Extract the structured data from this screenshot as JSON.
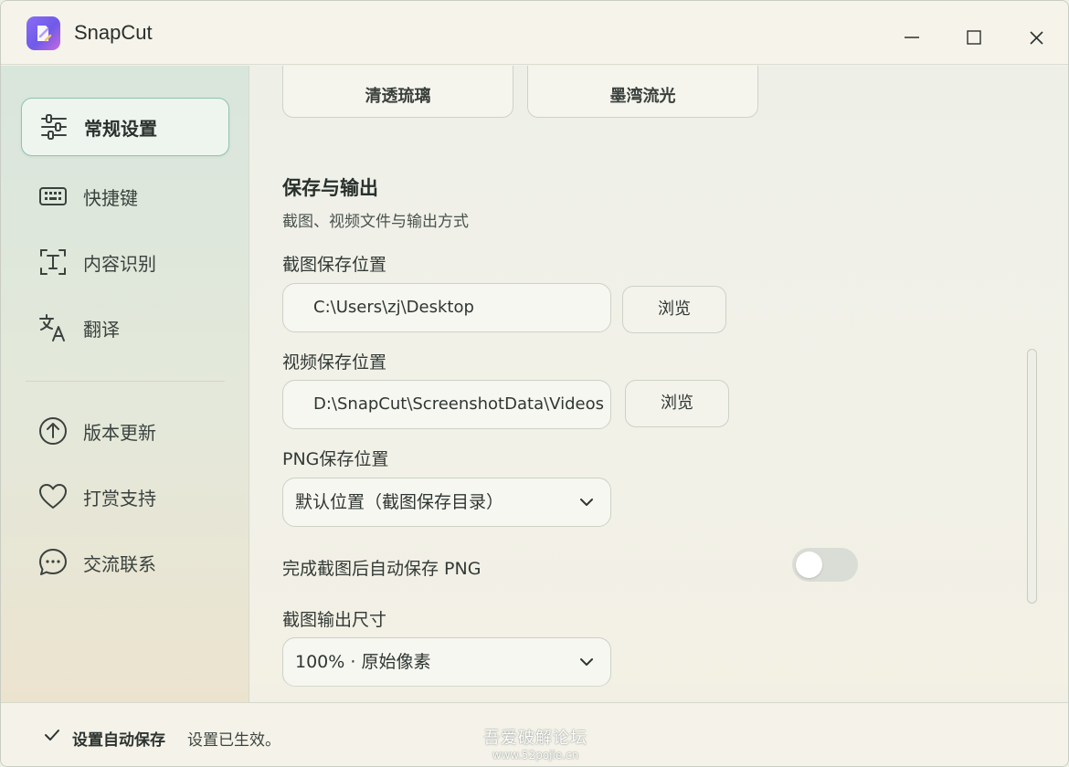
{
  "app": {
    "title": "SnapCut"
  },
  "sidebar": {
    "items": [
      {
        "label": "常规设置",
        "icon": "sliders-icon",
        "active": true
      },
      {
        "label": "快捷键",
        "icon": "keyboard-icon",
        "active": false
      },
      {
        "label": "内容识别",
        "icon": "text-scan-icon",
        "active": false
      },
      {
        "label": "翻译",
        "icon": "translate-icon",
        "active": false
      },
      {
        "label": "版本更新",
        "icon": "arrow-up-circle-icon",
        "active": false
      },
      {
        "label": "打赏支持",
        "icon": "heart-icon",
        "active": false
      },
      {
        "label": "交流联系",
        "icon": "chat-bubble-icon",
        "active": false
      }
    ]
  },
  "main": {
    "theme_buttons": [
      "清透琉璃",
      "墨湾流光"
    ],
    "section": {
      "title": "保存与输出",
      "subtitle": "截图、视频文件与输出方式"
    },
    "screenshot_path": {
      "label": "截图保存位置",
      "value": "C:\\Users\\zj\\Desktop",
      "browse": "浏览"
    },
    "video_path": {
      "label": "视频保存位置",
      "value": "D:\\SnapCut\\ScreenshotData\\Videos",
      "browse": "浏览"
    },
    "png_path": {
      "label": "PNG保存位置",
      "selected": "默认位置（截图保存目录）"
    },
    "auto_save_png": {
      "label": "完成截图后自动保存 PNG",
      "on": false
    },
    "output_size": {
      "label": "截图输出尺寸",
      "selected": "100% · 原始像素"
    }
  },
  "status": {
    "title": "设置自动保存",
    "message": "设置已生效。"
  },
  "watermark": {
    "main": "吾爱破解论坛",
    "sub": "www.52pojie.cn"
  }
}
